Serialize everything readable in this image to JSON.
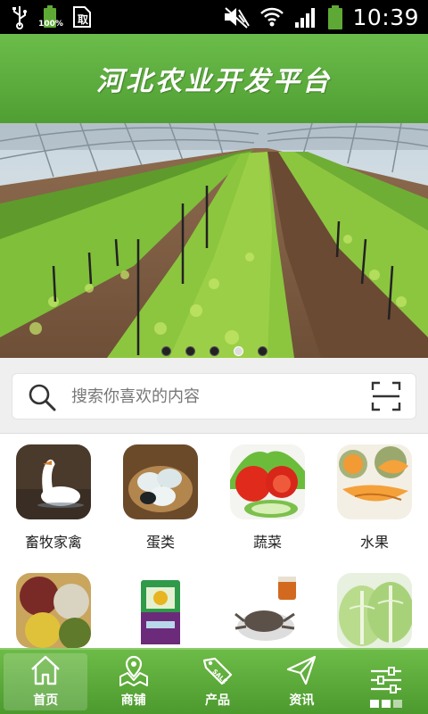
{
  "status_bar": {
    "battery_small_label": "100%",
    "time": "10:39",
    "icons": [
      "usb-icon",
      "battery-icon",
      "document-icon",
      "mute-icon",
      "wifi-icon",
      "signal-icon",
      "battery-icon"
    ]
  },
  "header": {
    "title": "河北农业开发平台"
  },
  "banner": {
    "slide_count": 5,
    "active_index": 3
  },
  "search": {
    "placeholder": "搜索你喜欢的内容"
  },
  "categories": [
    {
      "label": "畜牧家禽",
      "icon": "livestock-image"
    },
    {
      "label": "蛋类",
      "icon": "eggs-image"
    },
    {
      "label": "蔬菜",
      "icon": "vegetables-image"
    },
    {
      "label": "水果",
      "icon": "fruit-image"
    },
    {
      "label": "",
      "icon": "grains-image"
    },
    {
      "label": "",
      "icon": "rice-bag-image"
    },
    {
      "label": "",
      "icon": "crab-image"
    },
    {
      "label": "",
      "icon": "cabbage-image"
    }
  ],
  "nav": [
    {
      "label": "首页",
      "icon": "home-icon",
      "active": true
    },
    {
      "label": "商铺",
      "icon": "shop-map-icon",
      "active": false
    },
    {
      "label": "产品",
      "icon": "sale-tag-icon",
      "active": false
    },
    {
      "label": "资讯",
      "icon": "send-icon",
      "active": false
    },
    {
      "label": "",
      "icon": "settings-sliders-icon",
      "active": false
    }
  ],
  "colors": {
    "brand_green": "#5aab3a",
    "status_bar": "#000000"
  }
}
